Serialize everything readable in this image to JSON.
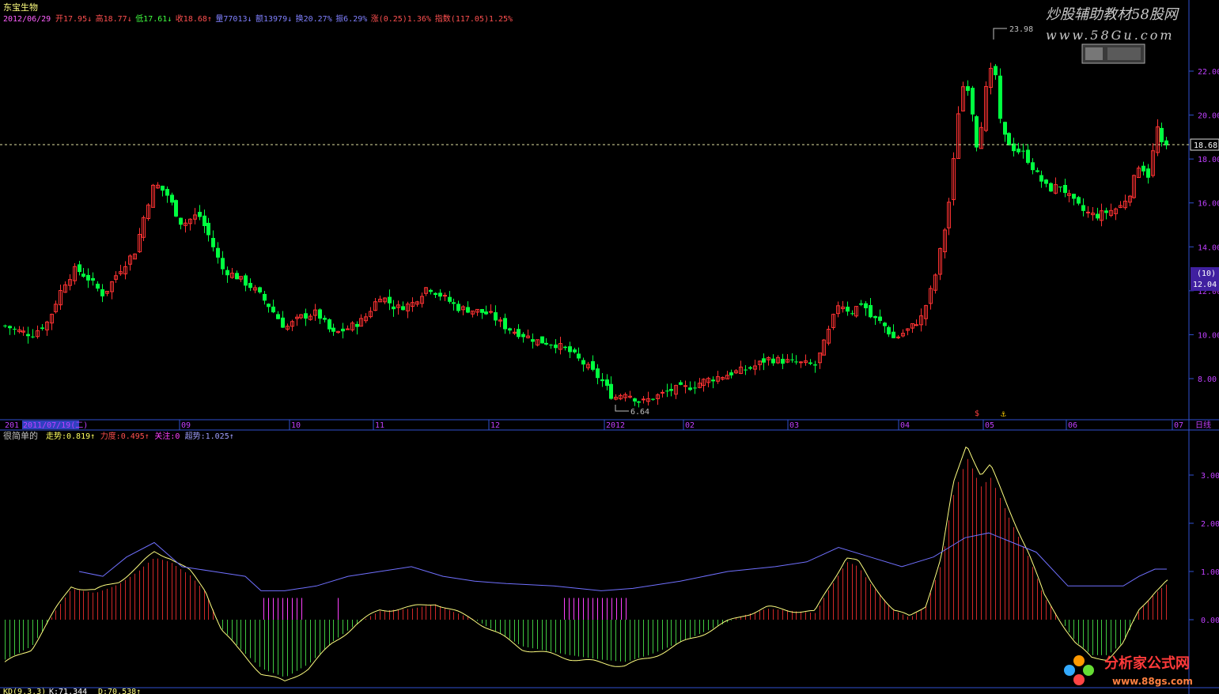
{
  "header": {
    "stock_name": "东宝生物",
    "date": "2012/06/29",
    "stats": [
      {
        "label": "开",
        "value": "17.95",
        "arrow": "↓",
        "color": "#ff5050"
      },
      {
        "label": "高",
        "value": "18.77",
        "arrow": "↓",
        "color": "#ff5050"
      },
      {
        "label": "低",
        "value": "17.61",
        "arrow": "↓",
        "color": "#40ff40"
      },
      {
        "label": "收",
        "value": "18.68",
        "arrow": "↑",
        "color": "#ff5050"
      },
      {
        "label": "量",
        "value": "77013",
        "arrow": "↓",
        "color": "#8080ff"
      },
      {
        "label": "额",
        "value": "13979",
        "arrow": "↓",
        "color": "#8080ff"
      },
      {
        "label": "换",
        "value": "20.27%",
        "arrow": "",
        "color": "#8080ff"
      },
      {
        "label": "振",
        "value": "6.29%",
        "arrow": "",
        "color": "#8080ff"
      },
      {
        "label": "涨",
        "value": "(0.25)1.36%",
        "arrow": "",
        "color": "#ff5050"
      },
      {
        "label": "指数",
        "value": "(117.05)1.25%",
        "arrow": "",
        "color": "#ff5050"
      }
    ]
  },
  "watermark": {
    "top_text": "炒股辅助教材58股网",
    "top_url": "www.58Gu.com",
    "bottom_text": "分析家公式网",
    "bottom_url": "www.88gs.com"
  },
  "price_axis": {
    "ticks": [
      "22.00",
      "20.00",
      "18.00",
      "16.00",
      "14.00",
      "12.00",
      "10.00",
      "8.00"
    ],
    "current_price": "18.68",
    "badge_top": "(10)",
    "badge_bottom": "12.04"
  },
  "annotations": {
    "high": "23.98",
    "low": "6.64"
  },
  "date_axis": {
    "cursor_date": "2011/07/19(二)",
    "start_fragment": "201",
    "months": [
      "09",
      "10",
      "11",
      "12",
      "2012",
      "02",
      "03",
      "04",
      "05",
      "06",
      "07"
    ],
    "period": "日线"
  },
  "indicator": {
    "name": "很简单的",
    "items": [
      {
        "label": "走势",
        "value": "0.819",
        "arrow": "↑",
        "color": "#ffff60"
      },
      {
        "label": "力度",
        "value": "0.495",
        "arrow": "↑",
        "color": "#ff5050"
      },
      {
        "label": "关注",
        "value": "0",
        "arrow": "",
        "color": "#ff40ff"
      },
      {
        "label": "超势",
        "value": "1.025",
        "arrow": "↑",
        "color": "#a0a0ff"
      }
    ],
    "ticks": [
      "3.00",
      "2.00",
      "1.00",
      "0.00"
    ]
  },
  "bottom_bar": {
    "text_left": "KD(9,3,3)",
    "text_k": "K:71.344",
    "text_d": "D:70.538↑"
  },
  "colors": {
    "up": "#ff3232",
    "down": "#00ff40",
    "axis": "#3050d0",
    "label_purple": "#c040ff"
  },
  "chart_data": {
    "type": "candlestick",
    "title": "东宝生物",
    "price_ticks": [
      22,
      20,
      18,
      16,
      14,
      12,
      10,
      8
    ],
    "ylim": [
      6.3,
      24.5
    ],
    "last_close": 18.68,
    "marked_high": 23.98,
    "marked_low": 6.64,
    "x_month_labels": [
      "09",
      "10",
      "11",
      "12",
      "2012",
      "02",
      "03",
      "04",
      "05",
      "06",
      "07"
    ]
  }
}
